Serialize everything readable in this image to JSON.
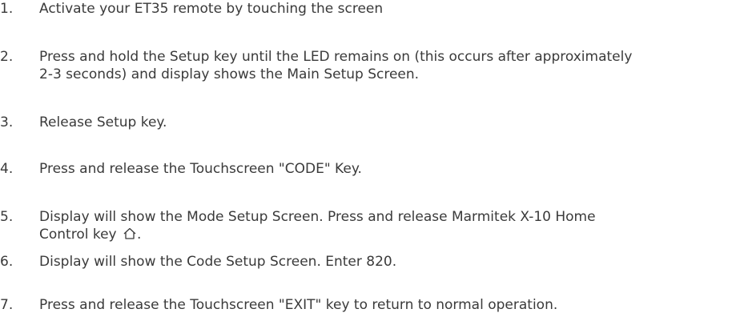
{
  "steps": [
    {
      "number": "1.",
      "lines": [
        "Activate your ET35 remote by touching the screen"
      ]
    },
    {
      "number": "2.",
      "lines": [
        "Press and hold the Setup key until the LED remains on (this occurs after approximately",
        "2-3 seconds) and display shows the Main Setup Screen."
      ]
    },
    {
      "number": "3.",
      "lines": [
        "Release Setup key."
      ]
    },
    {
      "number": "4.",
      "lines": [
        "Press and release the Touchscreen \"CODE\" Key."
      ]
    },
    {
      "number": "5.",
      "lines": [
        "Display will show the Mode Setup Screen. Press and release Marmitek X-10 Home",
        "Control key"
      ],
      "trailing": ".",
      "icon": "home-icon"
    },
    {
      "number": "6.",
      "lines": [
        "Display will show the Code Setup Screen. Enter 820."
      ]
    },
    {
      "number": "7.",
      "lines": [
        "Press and release the Touchscreen \"EXIT\" key to return to normal operation."
      ]
    }
  ]
}
